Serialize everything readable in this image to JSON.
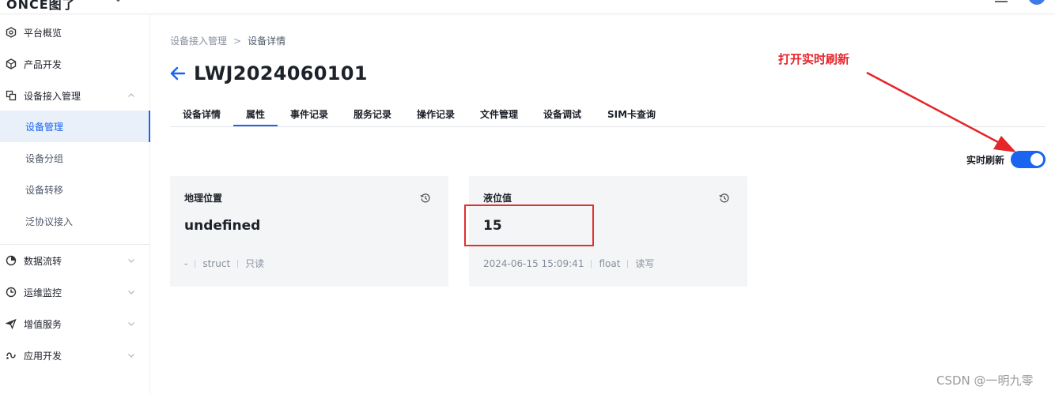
{
  "header": {
    "logo_text": "ONCE图了"
  },
  "sidebar": {
    "items": [
      {
        "label": "平台概览",
        "icon": "dashboard-icon"
      },
      {
        "label": "产品开发",
        "icon": "cube-icon"
      },
      {
        "label": "设备接入管理",
        "icon": "device-icon",
        "expanded": true
      },
      {
        "label": "设备管理",
        "active": true
      },
      {
        "label": "设备分组"
      },
      {
        "label": "设备转移"
      },
      {
        "label": "泛协议接入"
      },
      {
        "label": "数据流转",
        "icon": "flow-icon"
      },
      {
        "label": "运维监控",
        "icon": "monitor-icon"
      },
      {
        "label": "增值服务",
        "icon": "send-icon"
      },
      {
        "label": "应用开发",
        "icon": "app-icon"
      }
    ]
  },
  "breadcrumb": {
    "parent": "设备接入管理",
    "separator": ">",
    "current": "设备详情"
  },
  "device": {
    "title": "LWJ2024060101"
  },
  "tabs": [
    "设备详情",
    "属性",
    "事件记录",
    "服务记录",
    "操作记录",
    "文件管理",
    "设备调试",
    "SIM卡查询"
  ],
  "active_tab": "属性",
  "annotation": {
    "text": "打开实时刷新",
    "color": "#e5252a"
  },
  "realtime": {
    "label": "实时刷新",
    "enabled": true
  },
  "cards": [
    {
      "title": "地理位置",
      "value": "undefined",
      "time": "-",
      "type": "struct",
      "access": "只读"
    },
    {
      "title": "液位值",
      "value": "15",
      "time": "2024-06-15 15:09:41",
      "type": "float",
      "access": "读写"
    }
  ],
  "watermark": "CSDN @一明九零",
  "colors": {
    "accent": "#1a64f0",
    "annotation": "#e5252a"
  }
}
